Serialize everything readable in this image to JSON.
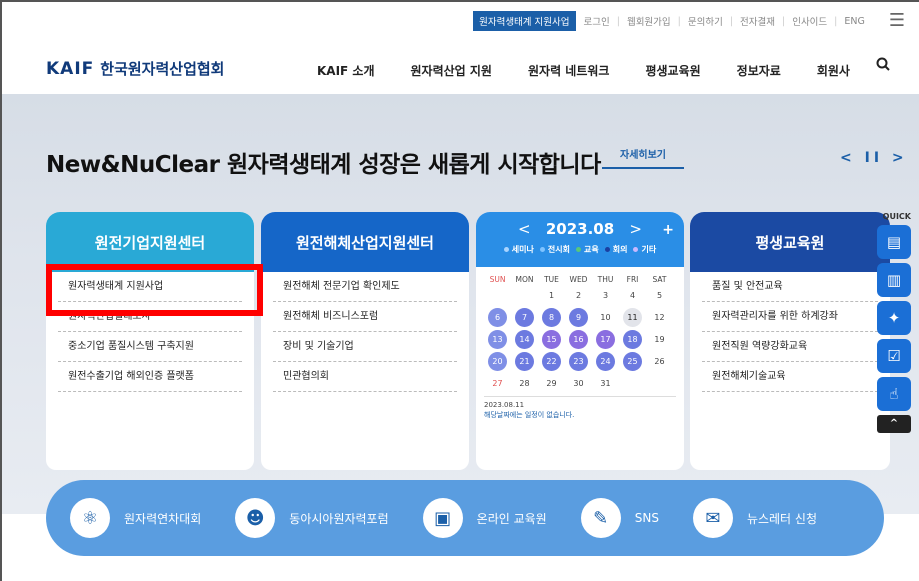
{
  "utility": {
    "highlight": "원자력생태계 지원사업",
    "links": [
      "로그인",
      "웹회원가입",
      "문의하기",
      "전자결재",
      "인사이드",
      "ENG"
    ],
    "menu_icon": "hamburger-icon"
  },
  "header": {
    "logo_en": "KAIF",
    "logo_ko": "한국원자력산업협회",
    "nav": [
      "KAIF 소개",
      "원자력산업 지원",
      "원자력 네트워크",
      "평생교육원",
      "정보자료",
      "회원사"
    ],
    "search_icon": "search-icon"
  },
  "hero": {
    "slogan": "New&NuClear 원자력생태계 성장은 새롭게 시작합니다",
    "more_label": "자세히보기",
    "prev": "<",
    "pause": "II",
    "next": ">"
  },
  "cards": {
    "c1": {
      "title": "원전기업지원센터",
      "items": [
        "원자력생태계 지원사업",
        "원자력산업실태조사",
        "중소기업 품질시스템 구축지원",
        "원전수출기업 해외인증 플랫폼"
      ]
    },
    "c2": {
      "title": "원전해체산업지원센터",
      "items": [
        "원전해체 전문기업 확인제도",
        "원전해체 비즈니스포럼",
        "장비 및 기술기업",
        "민관협의회"
      ]
    },
    "c4": {
      "title": "평생교육원",
      "items": [
        "품질 및 안전교육",
        "원자력관리자를 위한 하계강좌",
        "원전직원 역량강화교육",
        "원전해체기술교육"
      ]
    }
  },
  "calendar": {
    "title": "2023.08",
    "prev": "<",
    "next": ">",
    "plus": "+",
    "legend": [
      {
        "label": "세미나",
        "color": "#a9d4ff"
      },
      {
        "label": "전시회",
        "color": "#7fc3ff"
      },
      {
        "label": "교육",
        "color": "#58c77a"
      },
      {
        "label": "회의",
        "color": "#1b3fa0"
      },
      {
        "label": "기타",
        "color": "#c8b8ff"
      }
    ],
    "days": [
      "SUN",
      "MON",
      "TUE",
      "WED",
      "THU",
      "FRI",
      "SAT"
    ],
    "weeks": [
      [
        {
          "d": ""
        },
        {
          "d": ""
        },
        {
          "d": "1"
        },
        {
          "d": "2"
        },
        {
          "d": "3"
        },
        {
          "d": "4"
        },
        {
          "d": "5"
        }
      ],
      [
        {
          "d": "6",
          "c": "#7f8fe6"
        },
        {
          "d": "7",
          "c": "#6c7ae0"
        },
        {
          "d": "8",
          "c": "#6c7ae0"
        },
        {
          "d": "9",
          "c": "#6c7ae0"
        },
        {
          "d": "10"
        },
        {
          "d": "11",
          "c": "#e2e4ea",
          "t": "#222"
        },
        {
          "d": "12"
        }
      ],
      [
        {
          "d": "13",
          "c": "#7f8fe6"
        },
        {
          "d": "14",
          "c": "#6c7ae0"
        },
        {
          "d": "15",
          "c": "#8a6ee0"
        },
        {
          "d": "16",
          "c": "#8a6ee0"
        },
        {
          "d": "17",
          "c": "#8a6ee0"
        },
        {
          "d": "18",
          "c": "#6c7ae0"
        },
        {
          "d": "19"
        }
      ],
      [
        {
          "d": "20",
          "c": "#7f8fe6"
        },
        {
          "d": "21",
          "c": "#6c7ae0"
        },
        {
          "d": "22",
          "c": "#6c7ae0"
        },
        {
          "d": "23",
          "c": "#6c7ae0"
        },
        {
          "d": "24",
          "c": "#6c7ae0"
        },
        {
          "d": "25",
          "c": "#6c7ae0"
        },
        {
          "d": "26"
        }
      ],
      [
        {
          "d": "27"
        },
        {
          "d": "28"
        },
        {
          "d": "29"
        },
        {
          "d": "30"
        },
        {
          "d": "31"
        },
        {
          "d": ""
        },
        {
          "d": ""
        }
      ]
    ],
    "selected_date": "2023.08.11",
    "no_event": "해당날짜에는 일정이 없습니다."
  },
  "quick": {
    "label": "QUICK",
    "buttons": [
      "document-icon",
      "book-icon",
      "pin-icon",
      "checklist-icon",
      "thumbs-up-icon"
    ],
    "top_label": "^"
  },
  "bottom_links": [
    {
      "label": "원자력연차대회",
      "icon": "atom-icon",
      "glyph": "⚛"
    },
    {
      "label": "동아시아원자력포럼",
      "icon": "forum-icon",
      "glyph": "☻"
    },
    {
      "label": "온라인 교육원",
      "icon": "online-education-icon",
      "glyph": "▣"
    },
    {
      "label": "SNS",
      "icon": "sns-icon",
      "glyph": "✎"
    },
    {
      "label": "뉴스레터 신청",
      "icon": "newsletter-icon",
      "glyph": "✉"
    }
  ]
}
